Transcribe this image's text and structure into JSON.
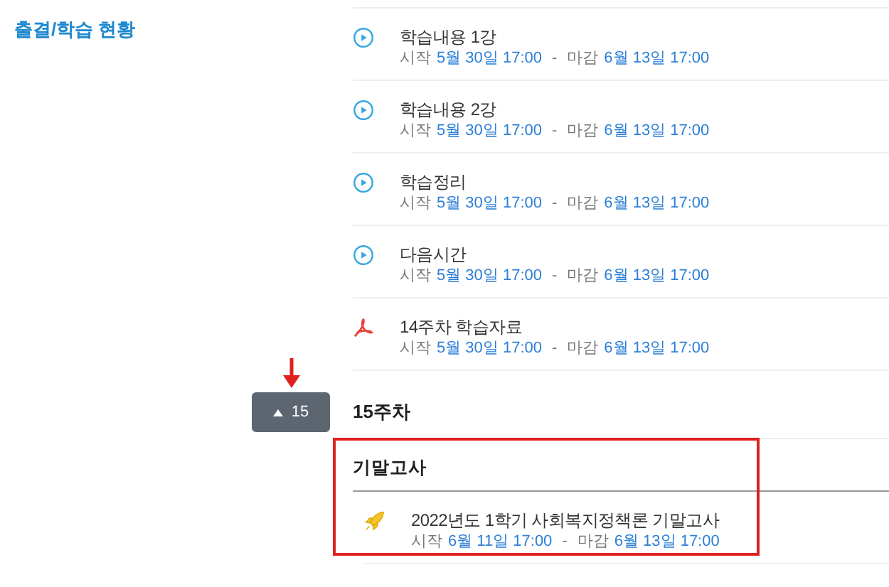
{
  "sidebar": {
    "heading": "출결/학습 현황"
  },
  "items": [
    {
      "kind": "video",
      "title": "학습내용 1강",
      "start_label": "시작",
      "start": "5월 30일 17:00",
      "separator": "-",
      "end_label": "마감",
      "end": "6월 13일 17:00"
    },
    {
      "kind": "video",
      "title": "학습내용 2강",
      "start_label": "시작",
      "start": "5월 30일 17:00",
      "separator": "-",
      "end_label": "마감",
      "end": "6월 13일 17:00"
    },
    {
      "kind": "video",
      "title": "학습정리",
      "start_label": "시작",
      "start": "5월 30일 17:00",
      "separator": "-",
      "end_label": "마감",
      "end": "6월 13일 17:00"
    },
    {
      "kind": "video",
      "title": "다음시간",
      "start_label": "시작",
      "start": "5월 30일 17:00",
      "separator": "-",
      "end_label": "마감",
      "end": "6월 13일 17:00"
    },
    {
      "kind": "pdf",
      "title": "14주차 학습자료",
      "start_label": "시작",
      "start": "5월 30일 17:00",
      "separator": "-",
      "end_label": "마감",
      "end": "6월 13일 17:00"
    }
  ],
  "week": {
    "badge": "15",
    "title": "15주차",
    "expanded": true
  },
  "section": {
    "heading": "기말고사",
    "items": [
      {
        "kind": "exam",
        "title": "2022년도 1학기 사회복지정책론 기말고사",
        "start_label": "시작",
        "start": "6월 11일 17:00",
        "separator": "-",
        "end_label": "마감",
        "end": "6월 13일 17:00"
      }
    ]
  }
}
